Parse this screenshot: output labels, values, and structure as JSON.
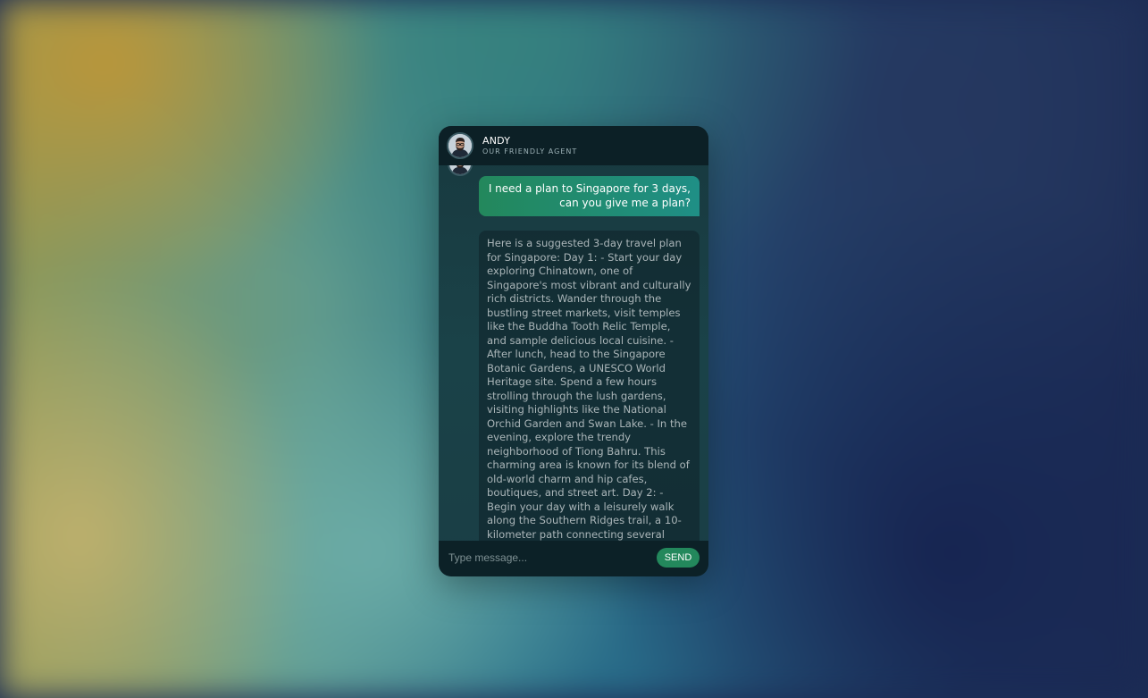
{
  "colors": {
    "user_bubble": "#23885c",
    "send_button": "#23885c",
    "panel": "#18393f"
  },
  "header": {
    "avatar_icon": "agent-avatar",
    "agent_name": "ANDY",
    "agent_role": "OUR FRIENDLY AGENT"
  },
  "messages": [
    {
      "sender": "user",
      "text": "I need a plan to Singapore for 3 days, can you give me a plan?"
    },
    {
      "sender": "agent",
      "text": "Here is a suggested 3-day travel plan for Singapore: Day 1: - Start your day exploring Chinatown, one of Singapore's most vibrant and culturally rich districts. Wander through the bustling street markets, visit temples like the Buddha Tooth Relic Temple, and sample delicious local cuisine. - After lunch, head to the Singapore Botanic Gardens, a UNESCO World Heritage site. Spend a few hours strolling through the lush gardens, visiting highlights like the National Orchid Garden and Swan Lake. - In the evening, explore the trendy neighborhood of Tiong Bahru. This charming area is known for its blend of old-world charm and hip cafes, boutiques, and street art. Day 2: - Begin your day with a leisurely walk along the Southern Ridges trail, a 10-kilometer path connecting several parks and gardens. Highlights include the scenic Henderson Waves bridge and Canopy Walk. - After your hike, visit"
    }
  ],
  "composer": {
    "placeholder": "Type message...",
    "send_label": "SEND"
  }
}
